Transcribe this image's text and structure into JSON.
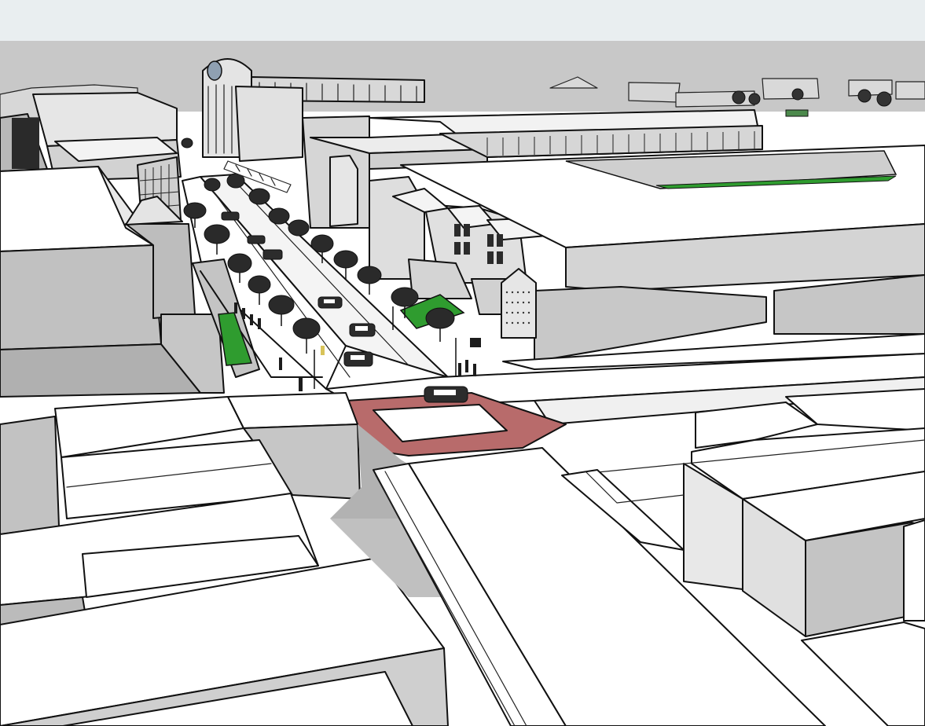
{
  "scene": {
    "kind": "3d-urban-massing-model",
    "colors": {
      "sky_top": "#e8ecee",
      "sky_bottom": "#c7c7c7",
      "roof": "#ffffff",
      "wall_light": "#d9d9d9",
      "wall_mid": "#bdbdbd",
      "wall_shadow": "#9c9c9c",
      "ground": "#ffffff",
      "ground_shadow": "#b5b5b5",
      "crosswalk": "#b86b6b",
      "grass": "#2e9d2e",
      "edge": "#111111"
    },
    "elements": {
      "main_street": "main-street",
      "crosswalk": "crosswalk",
      "cars": "cars",
      "trees": "street-trees",
      "pedestrians": "pedestrians"
    }
  }
}
